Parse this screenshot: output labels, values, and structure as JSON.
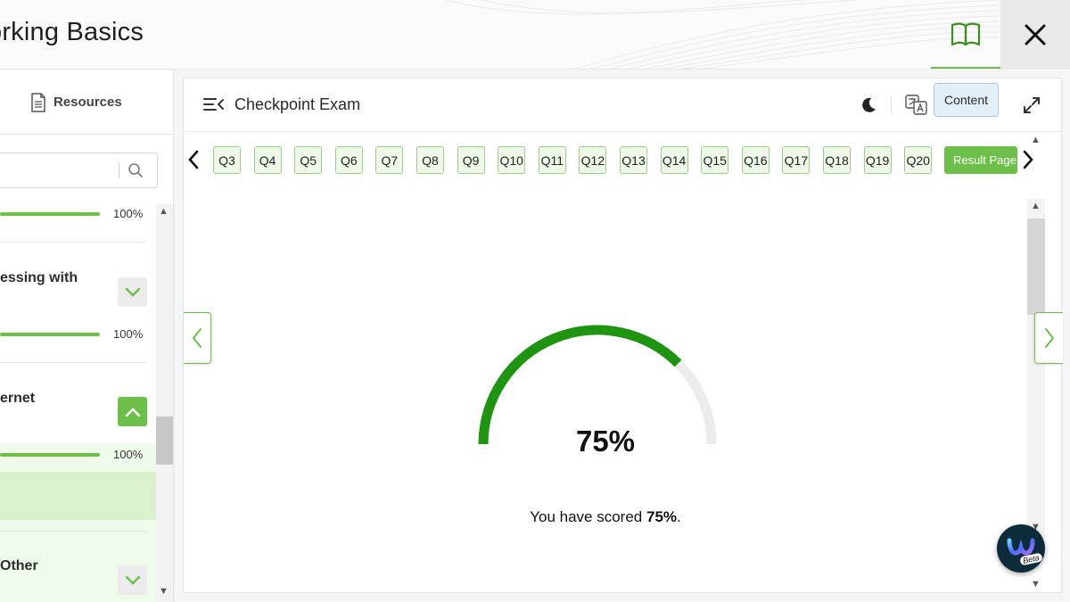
{
  "header": {
    "course_title": "orking Basics",
    "book_icon": "book-open-icon",
    "close_icon": "close-icon"
  },
  "sidebar": {
    "resources_label": "Resources",
    "search_placeholder": "",
    "modules": [
      {
        "title": "",
        "progress": 100,
        "progress_label": "100%",
        "state": "collapsed"
      },
      {
        "title": "essing with",
        "progress": 100,
        "progress_label": "100%",
        "state": "collapsed"
      },
      {
        "title": "ernet",
        "progress": 100,
        "progress_label": "100%",
        "state": "expanded"
      },
      {
        "title": "Other",
        "state": "collapsed"
      }
    ]
  },
  "toolbar": {
    "title": "Checkpoint Exam",
    "content_label": "Content"
  },
  "question_nav": {
    "items": [
      "Q3",
      "Q4",
      "Q5",
      "Q6",
      "Q7",
      "Q8",
      "Q9",
      "Q10",
      "Q11",
      "Q12",
      "Q13",
      "Q14",
      "Q15",
      "Q16",
      "Q17",
      "Q18",
      "Q19",
      "Q20"
    ],
    "result_label": "Result Page"
  },
  "result": {
    "score_percent": 75,
    "score_label": "75%",
    "scored_prefix": "You have scored ",
    "scored_value": "75%",
    "scored_suffix": "."
  },
  "assistant": {
    "badge": "Beta"
  },
  "colors": {
    "accent_green": "#6cc04a",
    "gauge_green": "#1e9410",
    "gauge_track": "#ececec",
    "content_button_bg": "#e3eff8"
  }
}
